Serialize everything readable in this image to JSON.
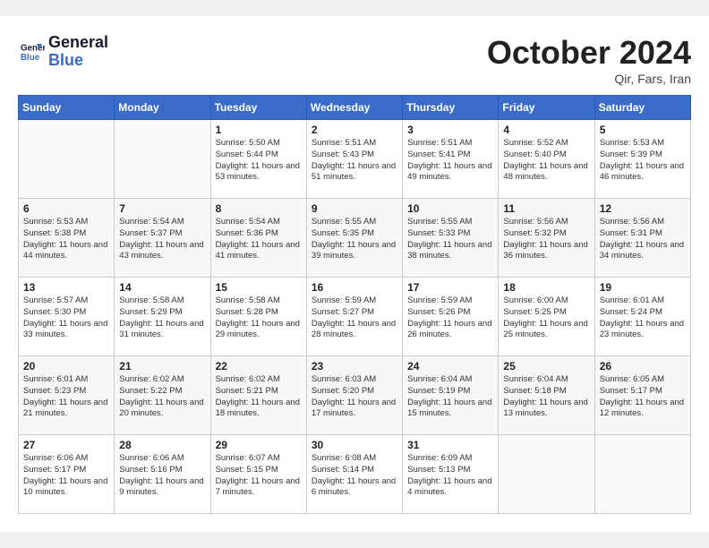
{
  "header": {
    "logo_line1": "General",
    "logo_line2": "Blue",
    "month": "October 2024",
    "location": "Qir, Fars, Iran"
  },
  "weekdays": [
    "Sunday",
    "Monday",
    "Tuesday",
    "Wednesday",
    "Thursday",
    "Friday",
    "Saturday"
  ],
  "weeks": [
    [
      {
        "day": "",
        "info": ""
      },
      {
        "day": "",
        "info": ""
      },
      {
        "day": "1",
        "info": "Sunrise: 5:50 AM\nSunset: 5:44 PM\nDaylight: 11 hours and 53 minutes."
      },
      {
        "day": "2",
        "info": "Sunrise: 5:51 AM\nSunset: 5:43 PM\nDaylight: 11 hours and 51 minutes."
      },
      {
        "day": "3",
        "info": "Sunrise: 5:51 AM\nSunset: 5:41 PM\nDaylight: 11 hours and 49 minutes."
      },
      {
        "day": "4",
        "info": "Sunrise: 5:52 AM\nSunset: 5:40 PM\nDaylight: 11 hours and 48 minutes."
      },
      {
        "day": "5",
        "info": "Sunrise: 5:53 AM\nSunset: 5:39 PM\nDaylight: 11 hours and 46 minutes."
      }
    ],
    [
      {
        "day": "6",
        "info": "Sunrise: 5:53 AM\nSunset: 5:38 PM\nDaylight: 11 hours and 44 minutes."
      },
      {
        "day": "7",
        "info": "Sunrise: 5:54 AM\nSunset: 5:37 PM\nDaylight: 11 hours and 43 minutes."
      },
      {
        "day": "8",
        "info": "Sunrise: 5:54 AM\nSunset: 5:36 PM\nDaylight: 11 hours and 41 minutes."
      },
      {
        "day": "9",
        "info": "Sunrise: 5:55 AM\nSunset: 5:35 PM\nDaylight: 11 hours and 39 minutes."
      },
      {
        "day": "10",
        "info": "Sunrise: 5:55 AM\nSunset: 5:33 PM\nDaylight: 11 hours and 38 minutes."
      },
      {
        "day": "11",
        "info": "Sunrise: 5:56 AM\nSunset: 5:32 PM\nDaylight: 11 hours and 36 minutes."
      },
      {
        "day": "12",
        "info": "Sunrise: 5:56 AM\nSunset: 5:31 PM\nDaylight: 11 hours and 34 minutes."
      }
    ],
    [
      {
        "day": "13",
        "info": "Sunrise: 5:57 AM\nSunset: 5:30 PM\nDaylight: 11 hours and 33 minutes."
      },
      {
        "day": "14",
        "info": "Sunrise: 5:58 AM\nSunset: 5:29 PM\nDaylight: 11 hours and 31 minutes."
      },
      {
        "day": "15",
        "info": "Sunrise: 5:58 AM\nSunset: 5:28 PM\nDaylight: 11 hours and 29 minutes."
      },
      {
        "day": "16",
        "info": "Sunrise: 5:59 AM\nSunset: 5:27 PM\nDaylight: 11 hours and 28 minutes."
      },
      {
        "day": "17",
        "info": "Sunrise: 5:59 AM\nSunset: 5:26 PM\nDaylight: 11 hours and 26 minutes."
      },
      {
        "day": "18",
        "info": "Sunrise: 6:00 AM\nSunset: 5:25 PM\nDaylight: 11 hours and 25 minutes."
      },
      {
        "day": "19",
        "info": "Sunrise: 6:01 AM\nSunset: 5:24 PM\nDaylight: 11 hours and 23 minutes."
      }
    ],
    [
      {
        "day": "20",
        "info": "Sunrise: 6:01 AM\nSunset: 5:23 PM\nDaylight: 11 hours and 21 minutes."
      },
      {
        "day": "21",
        "info": "Sunrise: 6:02 AM\nSunset: 5:22 PM\nDaylight: 11 hours and 20 minutes."
      },
      {
        "day": "22",
        "info": "Sunrise: 6:02 AM\nSunset: 5:21 PM\nDaylight: 11 hours and 18 minutes."
      },
      {
        "day": "23",
        "info": "Sunrise: 6:03 AM\nSunset: 5:20 PM\nDaylight: 11 hours and 17 minutes."
      },
      {
        "day": "24",
        "info": "Sunrise: 6:04 AM\nSunset: 5:19 PM\nDaylight: 11 hours and 15 minutes."
      },
      {
        "day": "25",
        "info": "Sunrise: 6:04 AM\nSunset: 5:18 PM\nDaylight: 11 hours and 13 minutes."
      },
      {
        "day": "26",
        "info": "Sunrise: 6:05 AM\nSunset: 5:17 PM\nDaylight: 11 hours and 12 minutes."
      }
    ],
    [
      {
        "day": "27",
        "info": "Sunrise: 6:06 AM\nSunset: 5:17 PM\nDaylight: 11 hours and 10 minutes."
      },
      {
        "day": "28",
        "info": "Sunrise: 6:06 AM\nSunset: 5:16 PM\nDaylight: 11 hours and 9 minutes."
      },
      {
        "day": "29",
        "info": "Sunrise: 6:07 AM\nSunset: 5:15 PM\nDaylight: 11 hours and 7 minutes."
      },
      {
        "day": "30",
        "info": "Sunrise: 6:08 AM\nSunset: 5:14 PM\nDaylight: 11 hours and 6 minutes."
      },
      {
        "day": "31",
        "info": "Sunrise: 6:09 AM\nSunset: 5:13 PM\nDaylight: 11 hours and 4 minutes."
      },
      {
        "day": "",
        "info": ""
      },
      {
        "day": "",
        "info": ""
      }
    ]
  ]
}
